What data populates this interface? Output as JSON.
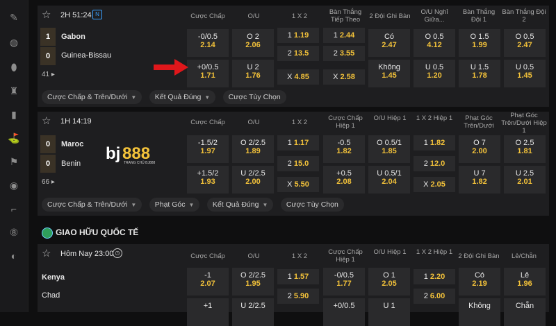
{
  "matches": [
    {
      "time": "2H 51:24",
      "badge": "N",
      "home": {
        "name": "Gabon",
        "score": "1"
      },
      "away": {
        "name": "Guinea-Bissau",
        "score": "0"
      },
      "more": "41",
      "columns": [
        "Cược Chấp",
        "O/U",
        "1 X 2",
        "Bàn Thắng Tiếp Theo",
        "2 Đội Ghi Bàn",
        "O/U Nghỉ Giữa...",
        "Bàn Thắng Đội 1",
        "Bàn Thắng Đội 2"
      ],
      "rows": [
        [
          [
            "-0/0.5",
            "2.14"
          ],
          [
            "O 2",
            "2.06"
          ],
          [
            "1",
            "1.19"
          ],
          [
            "1",
            "2.44"
          ],
          [
            "Có",
            "2.47"
          ],
          [
            "O 0.5",
            "4.12"
          ],
          [
            "O 1.5",
            "1.99"
          ],
          [
            "O 0.5",
            "2.47"
          ]
        ],
        [
          [
            "+0/0.5",
            "1.71"
          ],
          [
            "U 2",
            "1.76"
          ],
          [
            "2",
            "13.5"
          ],
          [
            "2",
            "3.55"
          ],
          [
            "Không",
            "1.45"
          ],
          [
            "U 0.5",
            "1.20"
          ],
          [
            "U 1.5",
            "1.78"
          ],
          [
            "U 0.5",
            "1.45"
          ]
        ],
        [
          null,
          null,
          [
            "X",
            "4.85"
          ],
          [
            "X",
            "2.58"
          ],
          null,
          null,
          null,
          null
        ]
      ],
      "chips": [
        "Cược Chấp & Trên/Dưới",
        "Kết Quả Đúng",
        "Cược Tùy Chọn"
      ]
    },
    {
      "time": "1H 14:19",
      "home": {
        "name": "Maroc",
        "score": "0"
      },
      "away": {
        "name": "Benin",
        "score": "0"
      },
      "more": "66",
      "columns": [
        "Cược Chấp",
        "O/U",
        "1 X 2",
        "Cược Chấp Hiệp 1",
        "O/U Hiệp 1",
        "1 X 2 Hiệp 1",
        "Phạt Góc Trên/Dưới",
        "Phạt Góc Trên/Dưới Hiệp 1"
      ],
      "rows": [
        [
          [
            "-1.5/2",
            "1.97"
          ],
          [
            "O 2/2.5",
            "1.89"
          ],
          [
            "1",
            "1.17"
          ],
          [
            "-0.5",
            "1.82"
          ],
          [
            "O 0.5/1",
            "1.85"
          ],
          [
            "1",
            "1.82"
          ],
          [
            "O 7",
            "2.00"
          ],
          [
            "O 2.5",
            "1.81"
          ]
        ],
        [
          null,
          null,
          [
            "2",
            "15.0"
          ],
          null,
          null,
          [
            "2",
            "12.0"
          ],
          null,
          null
        ],
        [
          [
            "+1.5/2",
            "1.93"
          ],
          [
            "U 2/2.5",
            "2.00"
          ],
          [
            "X",
            "5.50"
          ],
          [
            "+0.5",
            "2.08"
          ],
          [
            "U 0.5/1",
            "2.04"
          ],
          [
            "X",
            "2.05"
          ],
          [
            "U 7",
            "1.82"
          ],
          [
            "U 2.5",
            "2.01"
          ]
        ]
      ],
      "chips": [
        "Cược Chấp & Trên/Dưới",
        "Phạt Góc",
        "Kết Quả Đúng",
        "Cược Tùy Chọn"
      ]
    },
    {
      "time": "Hôm Nay 23:00",
      "home": {
        "name": "Kenya"
      },
      "away": {
        "name": "Chad"
      },
      "columns": [
        "Cược Chấp",
        "O/U",
        "1 X 2",
        "Cược Chấp Hiệp 1",
        "O/U Hiệp 1",
        "1 X 2 Hiệp 1",
        "2 Đội Ghi Bàn",
        "Lẻ/Chẵn"
      ],
      "rows": [
        [
          [
            "-1",
            "2.07"
          ],
          [
            "O 2/2.5",
            "1.95"
          ],
          [
            "1",
            "1.57"
          ],
          [
            "-0/0.5",
            "1.77"
          ],
          [
            "O 1",
            "2.05"
          ],
          [
            "1",
            "2.20"
          ],
          [
            "Có",
            "2.19"
          ],
          [
            "Lẻ",
            "1.96"
          ]
        ],
        [
          [
            "+1",
            ""
          ],
          [
            "U 2/2.5",
            ""
          ],
          [
            "2",
            "5.90"
          ],
          [
            "+0/0.5",
            ""
          ],
          [
            "U 1",
            ""
          ],
          [
            "2",
            "6.00"
          ],
          [
            "Không",
            ""
          ],
          [
            "Chẵn",
            ""
          ]
        ]
      ]
    }
  ],
  "section": {
    "title": "GIAO HỮU QUỐC TẾ"
  },
  "logo": {
    "text": "bj888",
    "tagline": "TRANG CHỦ BJ888"
  },
  "colors": {
    "odds": "#f3c23a",
    "accent_arrow": "#e0171b",
    "badge": "#3aa0ff"
  },
  "sidebar_icons": [
    "badminton-icon",
    "volleyball-icon",
    "football-icon",
    "trophy-icon",
    "cricket-icon",
    "golf-icon",
    "racing-flag-icon",
    "soccer-ball-icon",
    "hockey-icon",
    "eight-ball-icon",
    "baseball-icon"
  ]
}
